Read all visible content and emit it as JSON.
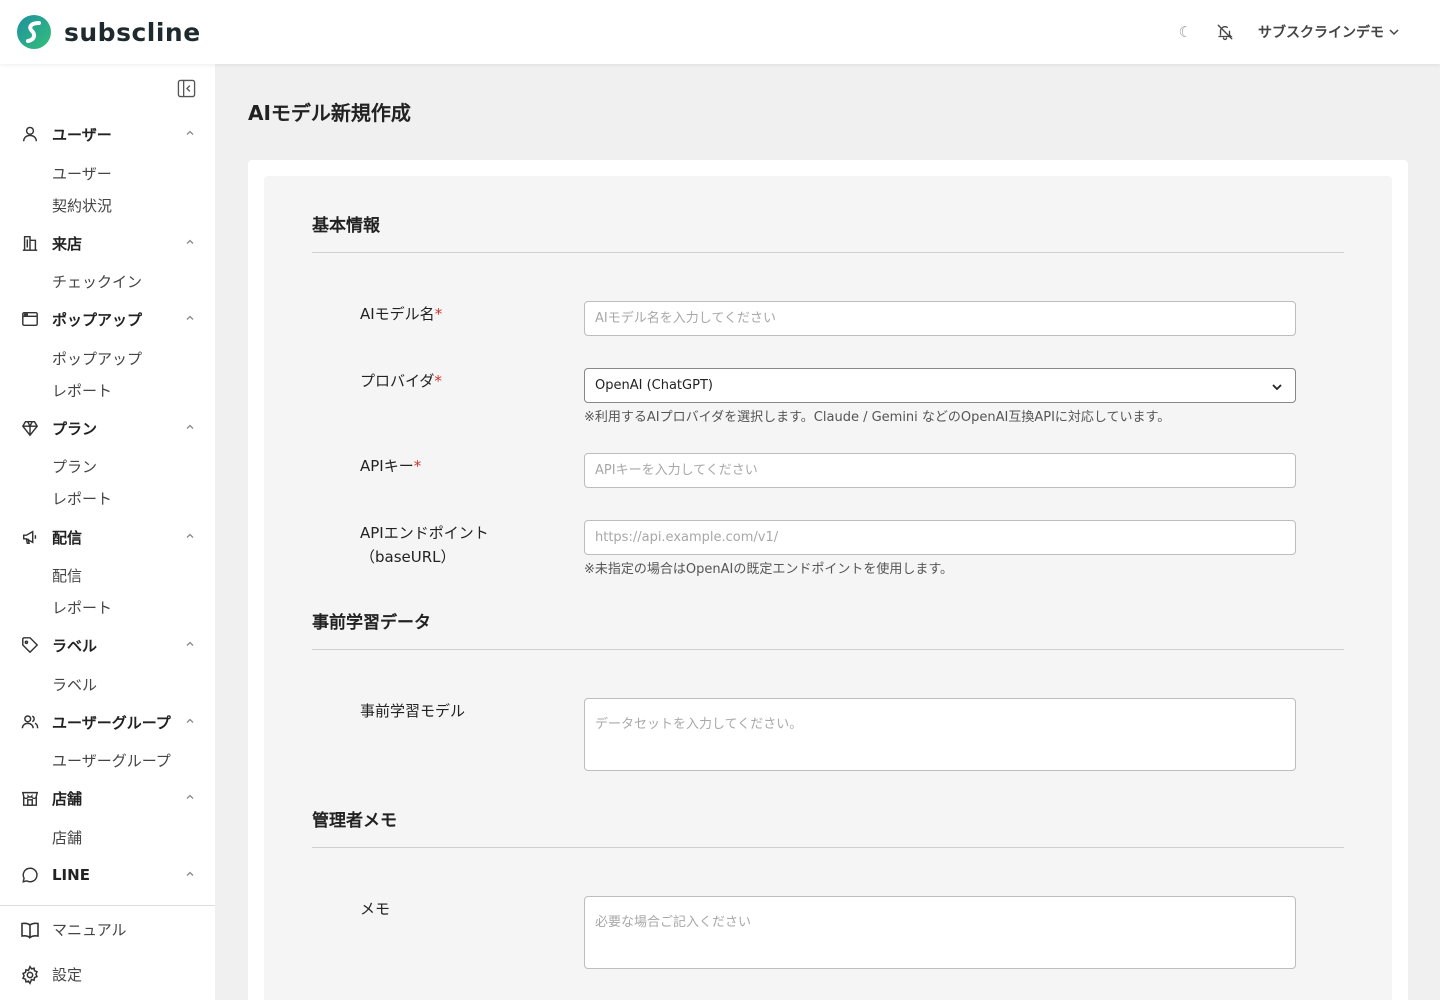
{
  "brand": {
    "name": "subscline",
    "color": "#1aa5a0"
  },
  "header": {
    "theme_icon": "☾",
    "user_label": "サブスクラインデモ"
  },
  "sidebar": {
    "groups": [
      {
        "label": "ユーザー",
        "icon": "user-icon",
        "items": [
          "ユーザー",
          "契約状況"
        ]
      },
      {
        "label": "来店",
        "icon": "building-icon",
        "items": [
          "チェックイン"
        ]
      },
      {
        "label": "ポップアップ",
        "icon": "window-icon",
        "items": [
          "ポップアップ",
          "レポート"
        ]
      },
      {
        "label": "プラン",
        "icon": "diamond-icon",
        "items": [
          "プラン",
          "レポート"
        ]
      },
      {
        "label": "配信",
        "icon": "megaphone-icon",
        "items": [
          "配信",
          "レポート"
        ]
      },
      {
        "label": "ラベル",
        "icon": "tag-icon",
        "items": [
          "ラベル"
        ]
      },
      {
        "label": "ユーザーグループ",
        "icon": "users-icon",
        "items": [
          "ユーザーグループ"
        ]
      },
      {
        "label": "店舗",
        "icon": "store-icon",
        "items": [
          "店舗"
        ]
      },
      {
        "label": "LINE",
        "icon": "chat-icon",
        "items": []
      }
    ],
    "bottom": [
      {
        "label": "マニュアル",
        "icon": "book-icon"
      },
      {
        "label": "設定",
        "icon": "gear-icon"
      }
    ]
  },
  "page": {
    "title": "AIモデル新規作成"
  },
  "form": {
    "sections": {
      "basic": "基本情報",
      "pretrain": "事前学習データ",
      "memo": "管理者メモ"
    },
    "required_mark": "*",
    "model_name": {
      "label": "AIモデル名",
      "placeholder": "AIモデル名を入力してください"
    },
    "provider": {
      "label": "プロバイダ",
      "value": "OpenAI (ChatGPT)",
      "hint": "※利用するAIプロバイダを選択します。Claude / Gemini などのOpenAI互換APIに対応しています。"
    },
    "api_key": {
      "label": "APIキー",
      "placeholder": "APIキーを入力してください"
    },
    "endpoint": {
      "label_line1": "APIエンドポイント",
      "label_line2": "（baseURL）",
      "placeholder": "https://api.example.com/v1/",
      "hint": "※未指定の場合はOpenAIの既定エンドポイントを使用します。"
    },
    "pretrain_model": {
      "label": "事前学習モデル",
      "placeholder": "データセットを入力してください。"
    },
    "memo": {
      "label": "メモ",
      "placeholder": "必要な場合ご記入ください"
    }
  }
}
